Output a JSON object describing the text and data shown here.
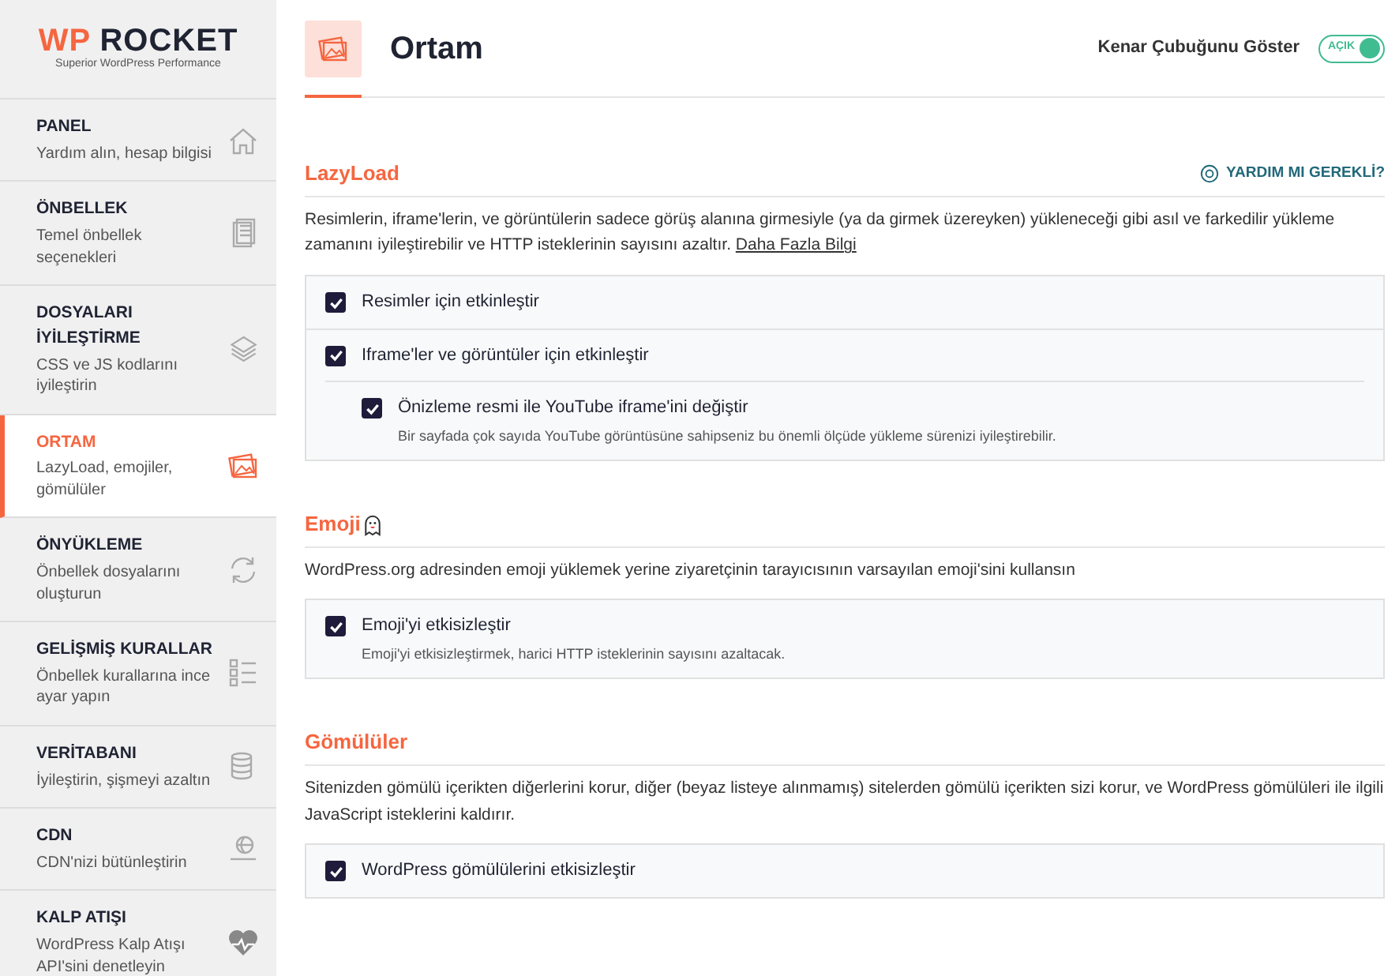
{
  "logo": {
    "brand_first": "WP",
    "brand_second": "ROCKET",
    "tagline": "Superior WordPress Performance"
  },
  "sidebar": {
    "items": [
      {
        "title": "PANEL",
        "subtitle": "Yardım alın, hesap bilgisi",
        "selected": false
      },
      {
        "title": "ÖNBELLEK",
        "subtitle": "Temel önbellek seçenekleri",
        "selected": false
      },
      {
        "title": "DOSYALARI İYİLEŞTİRME",
        "subtitle": "CSS ve JS kodlarını iyileştirin",
        "selected": false
      },
      {
        "title": "ORTAM",
        "subtitle": "LazyLoad, emojiler, gömülüler",
        "selected": true
      },
      {
        "title": "ÖNYÜKLEME",
        "subtitle": "Önbellek dosyalarını oluşturun",
        "selected": false
      },
      {
        "title": "GELİŞMİŞ KURALLAR",
        "subtitle": "Önbellek kurallarına ince ayar yapın",
        "selected": false
      },
      {
        "title": "VERİTABANI",
        "subtitle": "İyileştirin, şişmeyi azaltın",
        "selected": false
      },
      {
        "title": "CDN",
        "subtitle": "CDN'nizi bütünleştirin",
        "selected": false
      },
      {
        "title": "KALP ATIŞI",
        "subtitle": "WordPress Kalp Atışı API'sini denetleyin",
        "selected": false
      }
    ]
  },
  "header": {
    "title": "Ortam",
    "sidebar_toggle": {
      "label": "Kenar Çubuğunu Göster",
      "on": true,
      "state_text": "AÇIK"
    }
  },
  "sections": [
    {
      "title": "LazyLoad",
      "help_link": "YARDIM MI GEREKLİ?",
      "description": "Resimlerin, iframe'lerin, ve görüntülerin sadece görüş alanına girmesiyle (ya da girmek üzereyken) yükleneceği gibi asıl ve farkedilir yükleme zamanını iyileştirebilir ve HTTP isteklerinin sayısını azaltır.",
      "link": "Daha Fazla Bilgi",
      "options": [
        {
          "label": "Resimler için etkinleştir",
          "checked": true
        },
        {
          "label": "Iframe'ler ve görüntüler için etkinleştir",
          "checked": true,
          "children": [
            {
              "label": "Önizleme resmi ile YouTube iframe'ini değiştir",
              "description": "Bir sayfada çok sayıda YouTube görüntüsüne sahipseniz bu önemli ölçüde yükleme sürenizi iyileştirebilir.",
              "checked": true
            }
          ]
        }
      ]
    },
    {
      "title": "Emoji",
      "description": "WordPress.org adresinden emoji yüklemek yerine ziyaretçinin tarayıcısının varsayılan emoji'sini kullansın",
      "options": [
        {
          "label": "Emoji'yi etkisizleştir",
          "description": "Emoji'yi etkisizleştirmek, harici HTTP isteklerinin sayısını azaltacak.",
          "checked": true
        }
      ]
    },
    {
      "title": "Gömülüler",
      "description": "Sitenizden gömülü içerikten diğerlerini korur, diğer (beyaz listeye alınmamış) sitelerden gömülü içerikten sizi korur, ve WordPress gömülüleri ile ilgili JavaScript isteklerini kaldırır.",
      "options": [
        {
          "label": "WordPress gömülülerini etkisizleştir",
          "checked": true
        }
      ]
    }
  ]
}
